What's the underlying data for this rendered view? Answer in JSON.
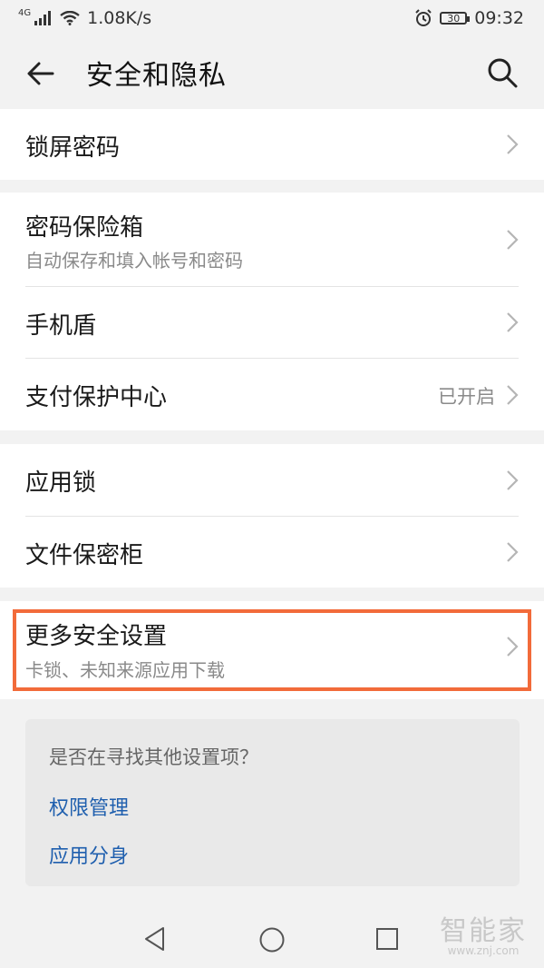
{
  "status_bar": {
    "net_type": "4G",
    "speed": "1.08K/s",
    "battery": "30",
    "time": "09:32",
    "icons": [
      "signal-icon",
      "wifi-icon",
      "alarm-icon",
      "battery-icon"
    ]
  },
  "header": {
    "title": "安全和隐私",
    "back_icon": "arrow-left-icon",
    "search_icon": "search-icon"
  },
  "sections": {
    "lock_screen": {
      "title": "锁屏密码"
    },
    "password_vault": {
      "title": "密码保险箱",
      "subtitle": "自动保存和填入帐号和密码"
    },
    "phone_shield": {
      "title": "手机盾"
    },
    "payment_protection": {
      "title": "支付保护中心",
      "value": "已开启"
    },
    "app_lock": {
      "title": "应用锁"
    },
    "file_safe": {
      "title": "文件保密柜"
    },
    "more_security": {
      "title": "更多安全设置",
      "subtitle": "卡锁、未知来源应用下载"
    }
  },
  "suggestion": {
    "question": "是否在寻找其他设置项？",
    "links": [
      "权限管理",
      "应用分身"
    ]
  },
  "highlight_color": "#f26b3a",
  "link_color": "#1f5fae",
  "watermark": {
    "text": "智能家",
    "url": "www.znj.com"
  }
}
